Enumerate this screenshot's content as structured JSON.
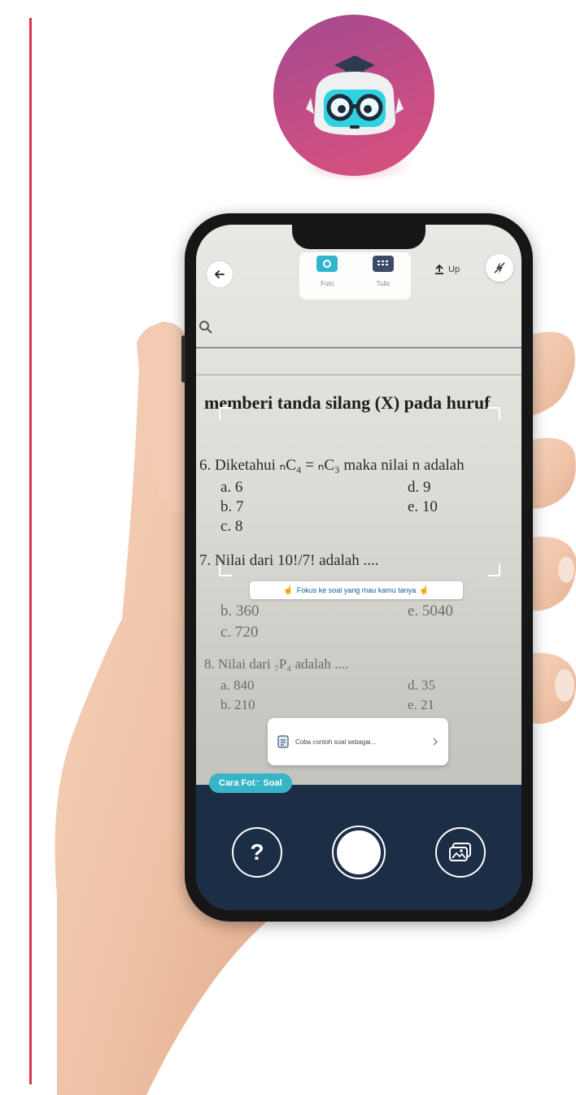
{
  "top_bar": {
    "mode_tabs": [
      {
        "label": "Foto",
        "icon": "camera-icon",
        "active": true
      },
      {
        "label": "Tulis",
        "icon": "keyboard-icon",
        "active": false
      }
    ],
    "upload_label": "Up"
  },
  "paper": {
    "heading": "memberi tanda silang (X) pada huruf",
    "lines": [
      "6.  Diketahui ₙC₄ = ₙC₃  maka nilai n adalah",
      "a.  6",
      "b.  7",
      "c.  8",
      "d.  9",
      "e.  10",
      "7.  Nilai dari  10!/7!  adalah ....",
      "b.  360",
      "e.  5040",
      "c.  720",
      "8.  Nilai dari  ₇P₄ adalah ....",
      "a.  840",
      "b.  210",
      "d.  35",
      "e.  21"
    ]
  },
  "focus_hint": "Fokus ke soal yang mau kamu tanya",
  "sample_card": {
    "label": "Coba contoh soal sebagai..."
  },
  "bottom_panel": {
    "tip_badge": "Cara Foto Soal",
    "help_symbol": "?"
  },
  "colors": {
    "accent_red": "#d9344a",
    "logo_purple": "#a34a8f",
    "logo_pink": "#d9517b",
    "panel_navy": "#1b2e45",
    "tip_teal": "#37b5c7"
  }
}
